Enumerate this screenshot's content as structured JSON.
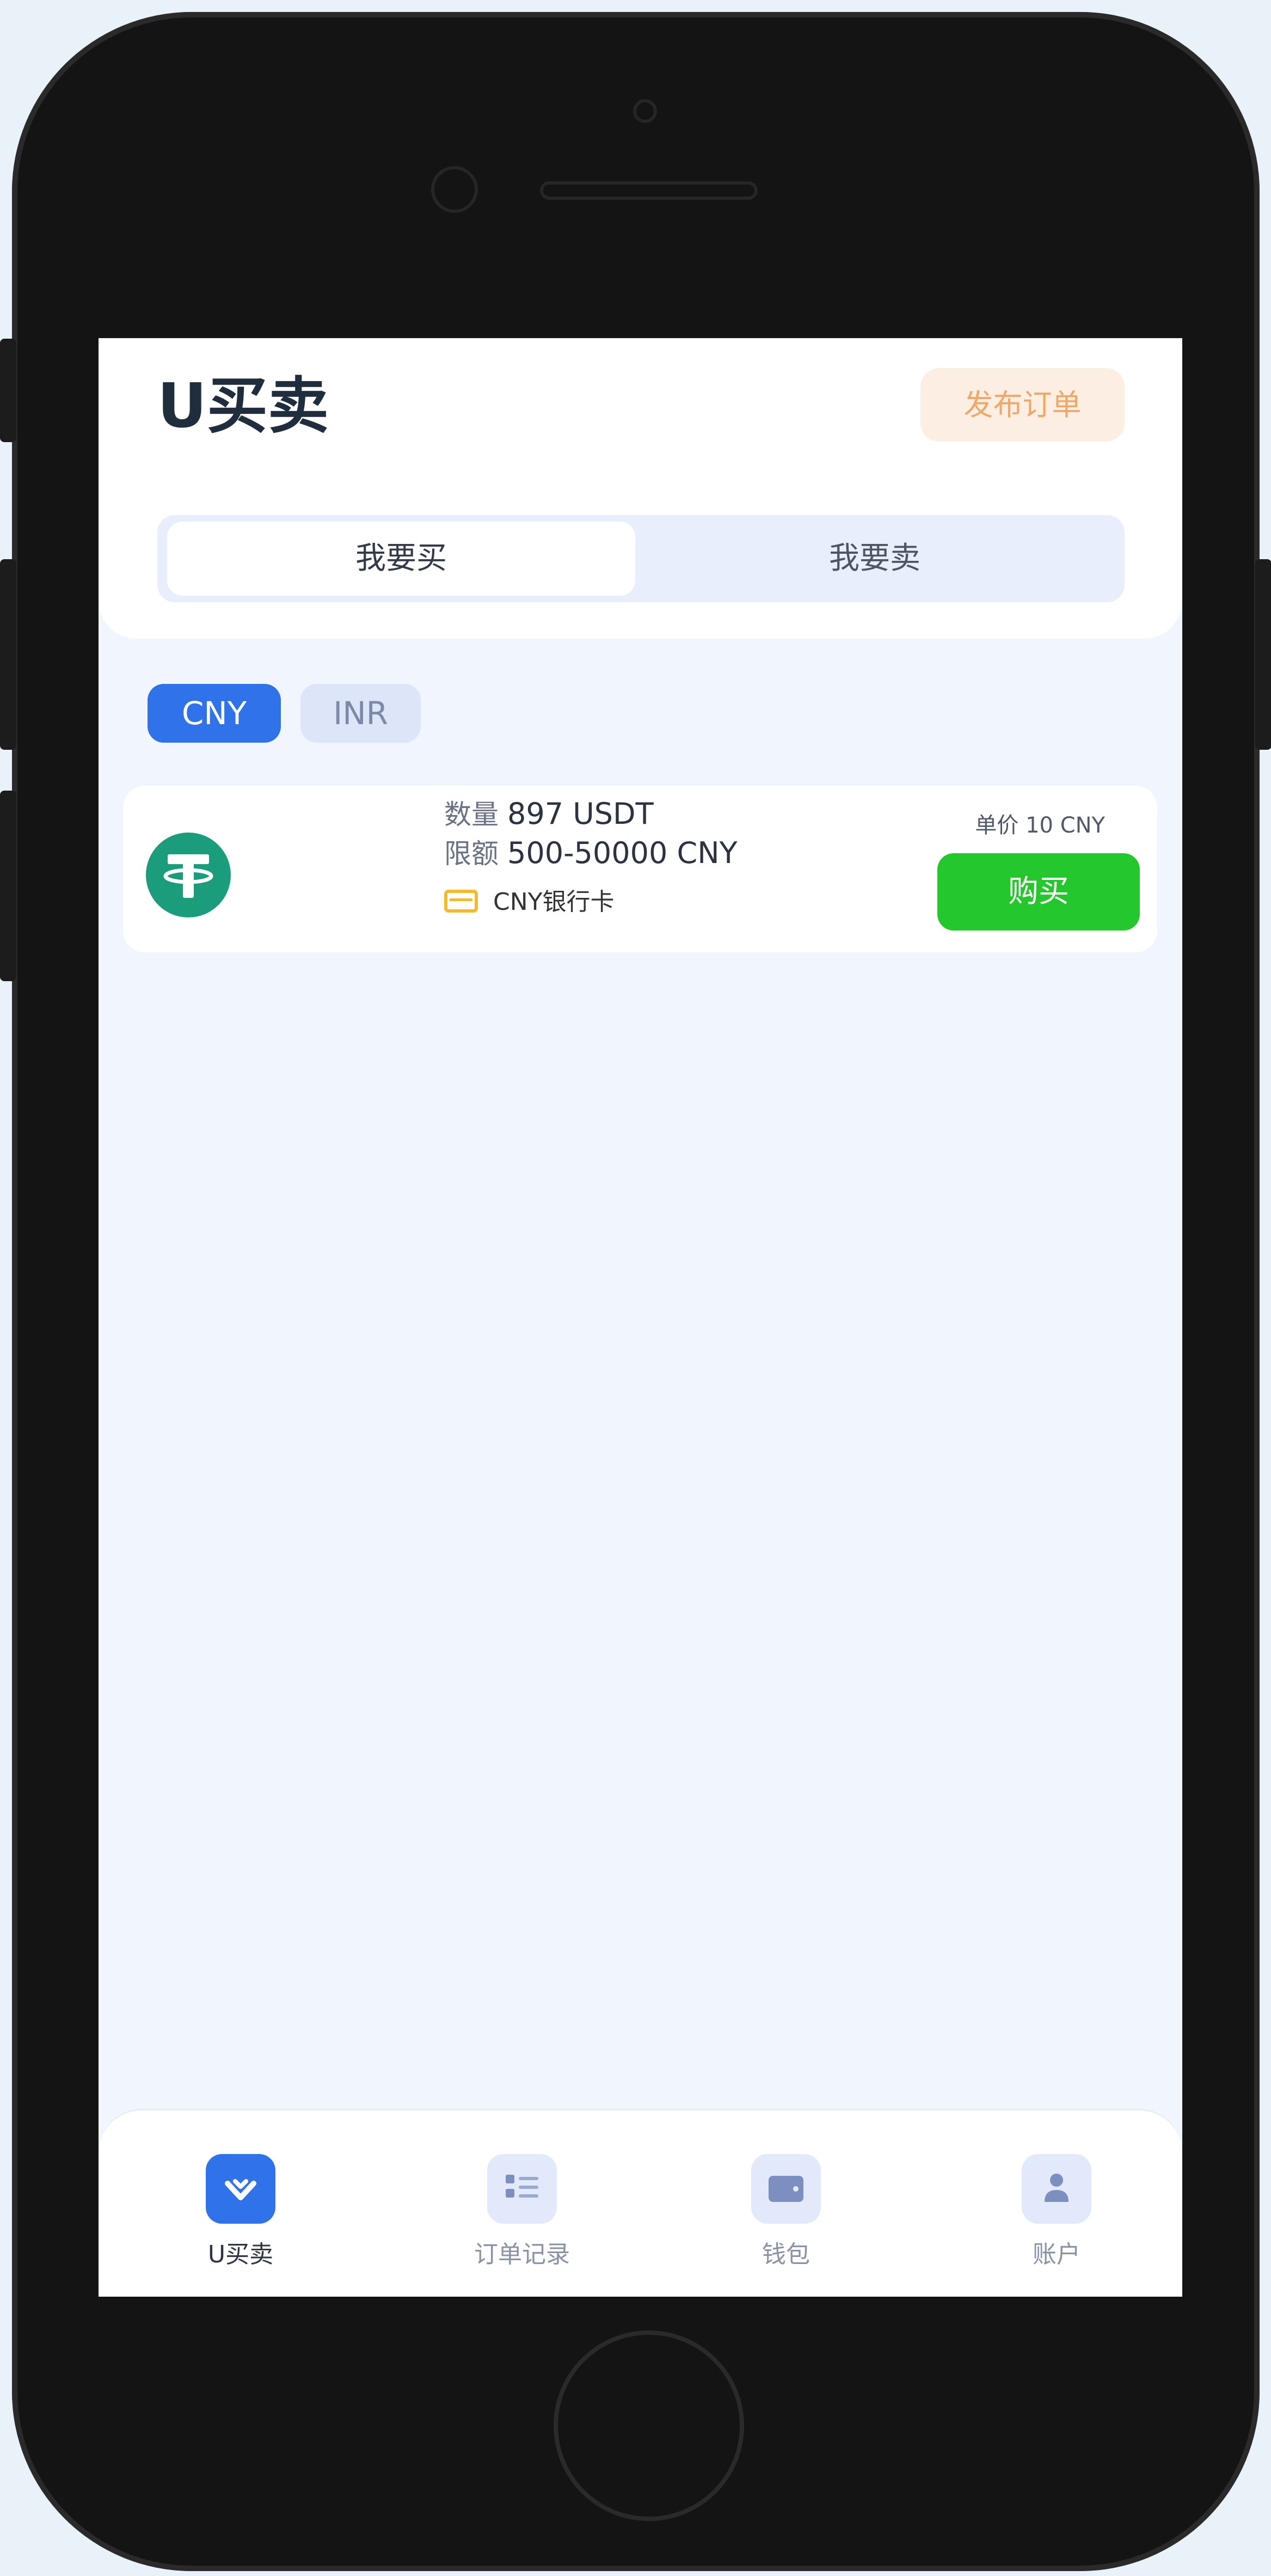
{
  "header": {
    "title": "U买卖",
    "publish_label": "发布订单"
  },
  "segment": {
    "buy_label": "我要买",
    "sell_label": "我要卖"
  },
  "currencies": [
    "CNY",
    "INR"
  ],
  "listing": {
    "quantity_label": "数量",
    "quantity_value": "897 USDT",
    "limit_label": "限额",
    "limit_value": "500-50000 CNY",
    "payment_method": "CNY银行卡",
    "unit_price": "单价 10 CNY",
    "buy_label": "购买"
  },
  "tabbar": [
    {
      "label": "U买卖",
      "icon": "diamond-icon"
    },
    {
      "label": "订单记录",
      "icon": "list-icon"
    },
    {
      "label": "钱包",
      "icon": "wallet-icon"
    },
    {
      "label": "账户",
      "icon": "user-icon"
    }
  ],
  "colors": {
    "accent": "#2f72e9",
    "buy_button": "#25c82c",
    "tether": "#1b9c7b",
    "publish_bg": "#fdeee4",
    "publish_text": "#f0a868"
  }
}
